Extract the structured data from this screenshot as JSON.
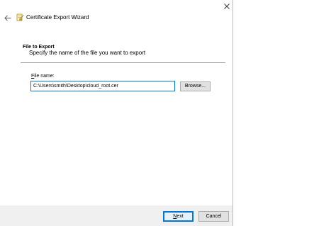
{
  "window": {
    "title": "Certificate Export Wizard",
    "back_icon": "back-arrow-icon",
    "wizard_icon": "certificate-wizard-icon",
    "close_icon": "close-icon"
  },
  "section": {
    "heading": "File to Export",
    "description": "Specify the name of the file you want to export"
  },
  "file_field": {
    "label_accel": "F",
    "label_rest": "ile name:",
    "value": "C:\\Users\\smith\\Desktop\\cloud_root.cer"
  },
  "buttons": {
    "browse": "Browse...",
    "next": "Next",
    "cancel": "Cancel"
  },
  "colors": {
    "focus_accent": "#0078d7",
    "footer_background": "#f0f0f0",
    "button_background": "#e1e1e1"
  }
}
